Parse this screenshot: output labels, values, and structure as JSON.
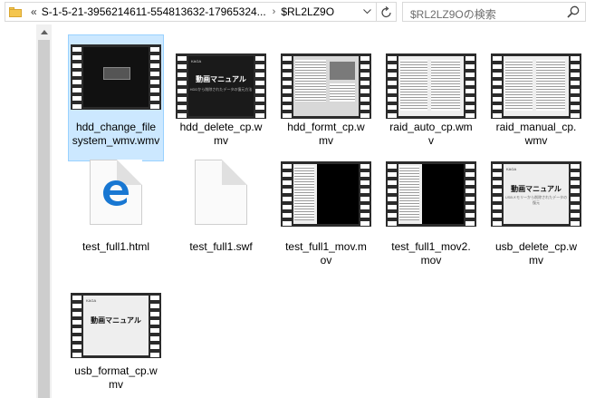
{
  "address_bar": {
    "overflow": "«",
    "path": "S-1-5-21-3956214611-554813632-17965324...",
    "separator": "›",
    "current": "$RL2LZ9O",
    "dropdown_icon": "chevron-down-icon",
    "refresh_icon": "refresh-icon"
  },
  "search": {
    "placeholder": "$RL2LZ9Oの検索",
    "icon": "search-icon"
  },
  "files": [
    {
      "name": "hdd_change_filesystem_wmv.wmv",
      "line1": "hdd_change_file",
      "line2": "system_wmv.wmv",
      "kind": "video",
      "selected": true
    },
    {
      "name": "hdd_delete_cp.wmv",
      "line1": "hdd_delete_cp.w",
      "line2": "mv",
      "kind": "video",
      "frame_title": "動画マニュアル",
      "frame_sub": "HDDから削除されたデータの復元方法"
    },
    {
      "name": "hdd_formt_cp.wmv",
      "line1": "hdd_formt_cp.w",
      "line2": "mv",
      "kind": "video"
    },
    {
      "name": "raid_auto_cp.wmv",
      "line1": "raid_auto_cp.wm",
      "line2": "v",
      "kind": "video"
    },
    {
      "name": "raid_manual_cp.wmv",
      "line1": "raid_manual_cp.",
      "line2": "wmv",
      "kind": "video"
    },
    {
      "name": "test_full1.html",
      "line1": "test_full1.html",
      "line2": "",
      "kind": "html"
    },
    {
      "name": "test_full1.swf",
      "line1": "test_full1.swf",
      "line2": "",
      "kind": "blank"
    },
    {
      "name": "test_full1_mov.mov",
      "line1": "test_full1_mov.m",
      "line2": "ov",
      "kind": "video"
    },
    {
      "name": "test_full1_mov2.mov",
      "line1": "test_full1_mov2.",
      "line2": "mov",
      "kind": "video"
    },
    {
      "name": "usb_delete_cp.wmv",
      "line1": "usb_delete_cp.w",
      "line2": "mv",
      "kind": "video",
      "frame_title": "動画マニュアル",
      "frame_sub": "USBメモリーから削除されたデータの復元"
    },
    {
      "name": "usb_format_cp.wmv",
      "line1": "usb_format_cp.w",
      "line2": "mv",
      "kind": "video",
      "frame_title": "動画マニュアル"
    }
  ]
}
